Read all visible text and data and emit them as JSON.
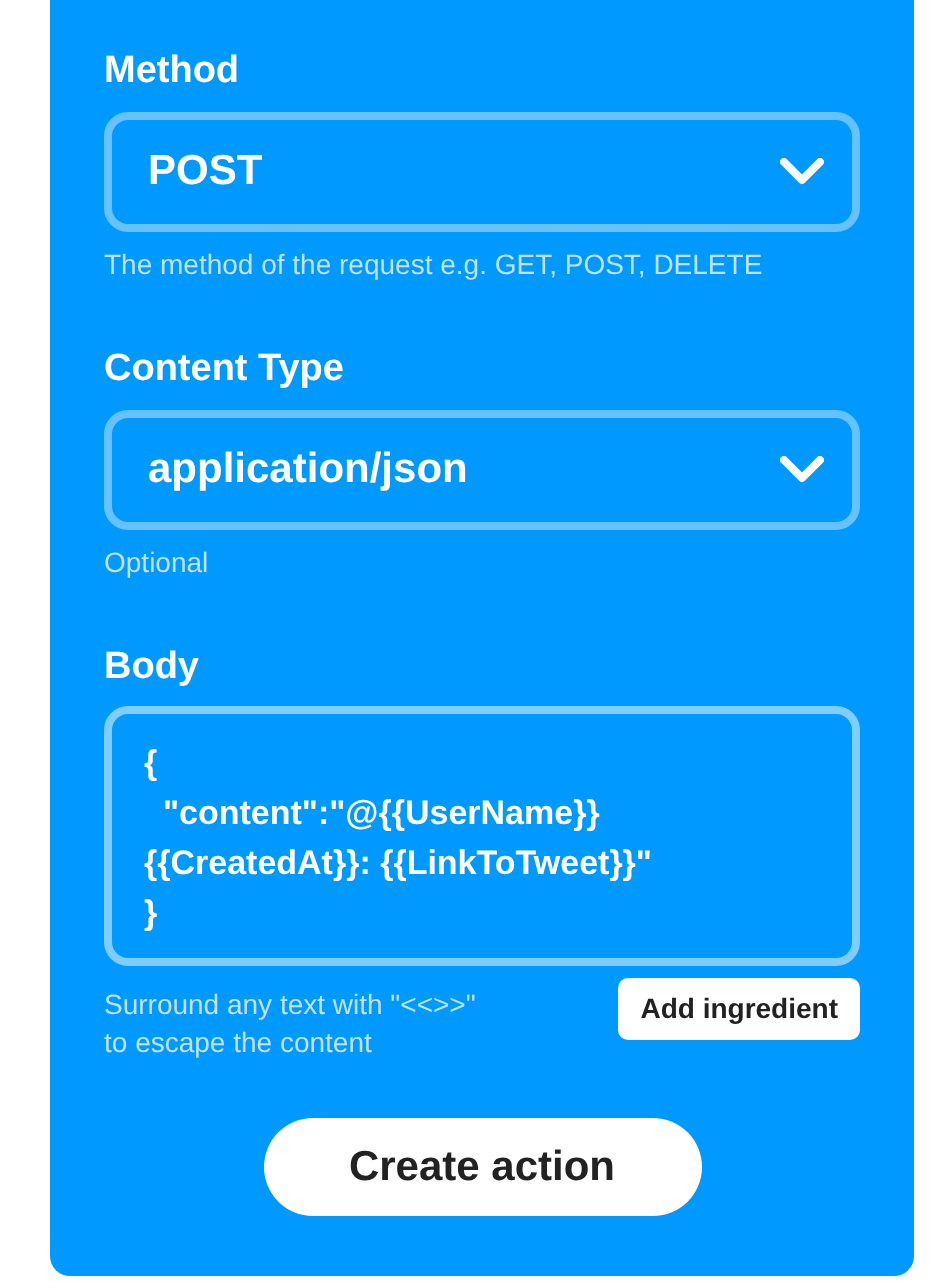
{
  "fields": [
    {
      "kind": "select",
      "label": "Method",
      "value": "POST",
      "hint": "The method of the request e.g. GET, POST, DELETE"
    },
    {
      "kind": "select",
      "label": "Content Type",
      "value": "application/json",
      "hint": "Optional"
    },
    {
      "kind": "textarea",
      "label": "Body",
      "lines": [
        "{",
        "  \"content\":\"@{{UserName}}",
        "{{CreatedAt}}: {{LinkToTweet}}\"",
        "}"
      ],
      "hint_lines": [
        "Surround any text with \"<<>>\"",
        "to escape the content"
      ],
      "action": "Add ingredient"
    }
  ],
  "submit": "Create action"
}
